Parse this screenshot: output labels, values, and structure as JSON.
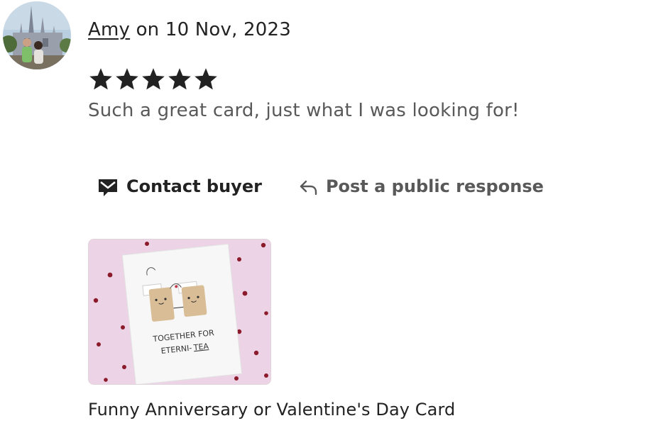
{
  "review": {
    "author": "Amy",
    "date_text": " on 10 Nov, 2023",
    "rating": 5,
    "rating_max": 5,
    "text": "Such a great card, just what I was looking for!"
  },
  "actions": {
    "contact_label": "Contact buyer",
    "respond_label": "Post a public response"
  },
  "listing": {
    "card_text_line1": "TOGETHER FOR",
    "card_text_line2_prefix": "ETERNI-",
    "card_text_line2_suffix": "TEA",
    "title": "Funny Anniversary or Valentine's Day Card"
  },
  "colors": {
    "text_primary": "#222222",
    "text_secondary": "#595959",
    "card_background": "#ecd4e6",
    "heart": "#8b1a2b"
  },
  "icons": {
    "contact": "envelope-icon",
    "respond": "reply-arrow-icon",
    "star": "star-icon"
  }
}
